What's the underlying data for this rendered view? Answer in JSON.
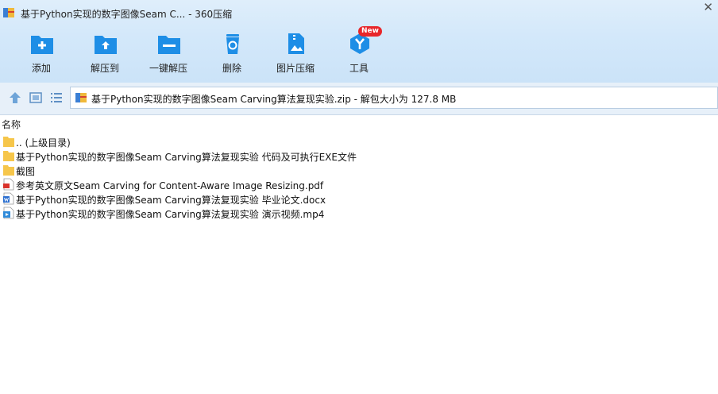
{
  "window": {
    "title": "基于Python实现的数字图像Seam C... - 360压缩",
    "close_glyph": "✕"
  },
  "toolbar": {
    "items": [
      {
        "label": "添加",
        "icon": "folder-add-icon"
      },
      {
        "label": "解压到",
        "icon": "folder-extract-icon"
      },
      {
        "label": "一键解压",
        "icon": "folder-oneclick-extract-icon"
      },
      {
        "label": "删除",
        "icon": "recycle-bin-icon"
      },
      {
        "label": "图片压缩",
        "icon": "image-compress-icon"
      },
      {
        "label": "工具",
        "icon": "tools-icon"
      }
    ],
    "badge": "New"
  },
  "address": {
    "text": "基于Python实现的数字图像Seam Carving算法复现实验.zip - 解包大小为 127.8 MB"
  },
  "list": {
    "column_name": "名称",
    "rows": [
      {
        "name": ".. (上级目录)",
        "type": "folder"
      },
      {
        "name": "基于Python实现的数字图像Seam Carving算法复现实验 代码及可执行EXE文件",
        "type": "folder"
      },
      {
        "name": "截图",
        "type": "folder"
      },
      {
        "name": "参考英文原文Seam Carving for Content-Aware Image Resizing.pdf",
        "type": "pdf"
      },
      {
        "name": "基于Python实现的数字图像Seam Carving算法复现实验 毕业论文.docx",
        "type": "docx"
      },
      {
        "name": "基于Python实现的数字图像Seam Carving算法复现实验 演示视频.mp4",
        "type": "mp4"
      }
    ]
  },
  "colors": {
    "accent_blue": "#1e8ee6",
    "folder_yellow": "#f6c64a",
    "badge_red": "#e8262a"
  }
}
